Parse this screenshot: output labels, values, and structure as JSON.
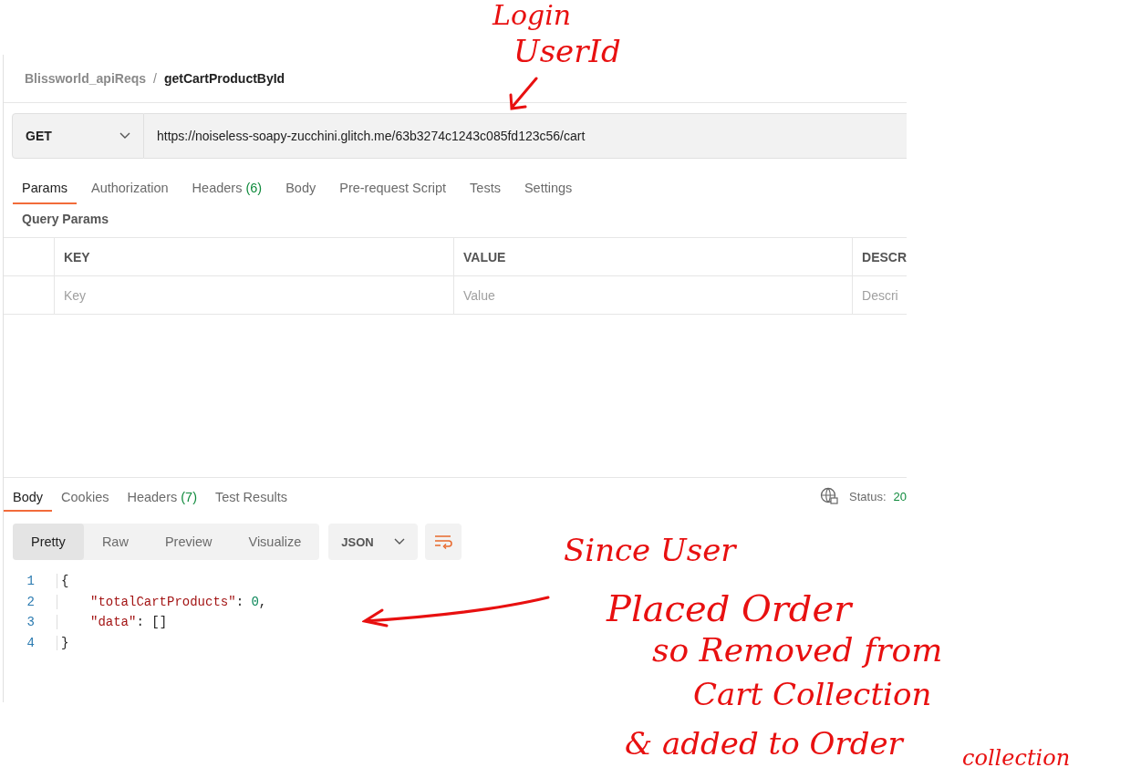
{
  "breadcrumb": {
    "collection": "Blissworld_apiReqs",
    "separator": "/",
    "request": "getCartProductById"
  },
  "request": {
    "method": "GET",
    "url": "https://noiseless-soapy-zucchini.glitch.me/63b3274c1243c085fd123c56/cart"
  },
  "request_tabs": [
    {
      "label": "Params",
      "selected": true
    },
    {
      "label": "Authorization",
      "selected": false
    },
    {
      "label": "Headers",
      "count": "(6)",
      "selected": false
    },
    {
      "label": "Body",
      "selected": false
    },
    {
      "label": "Pre-request Script",
      "selected": false
    },
    {
      "label": "Tests",
      "selected": false
    },
    {
      "label": "Settings",
      "selected": false
    }
  ],
  "query_params": {
    "title": "Query Params",
    "columns": [
      "KEY",
      "VALUE",
      "DESCR"
    ],
    "rows": [
      {
        "key_placeholder": "Key",
        "value_placeholder": "Value",
        "description_placeholder": "Descri"
      }
    ]
  },
  "response": {
    "tabs": [
      {
        "label": "Body",
        "selected": true
      },
      {
        "label": "Cookies",
        "selected": false
      },
      {
        "label": "Headers",
        "count": "(7)",
        "selected": false
      },
      {
        "label": "Test Results",
        "selected": false
      }
    ],
    "status_label": "Status:",
    "status_value": "20",
    "view_modes": [
      {
        "label": "Pretty",
        "selected": true
      },
      {
        "label": "Raw",
        "selected": false
      },
      {
        "label": "Preview",
        "selected": false
      },
      {
        "label": "Visualize",
        "selected": false
      }
    ],
    "format": "JSON",
    "code_lines": [
      {
        "number": "1",
        "indented": false,
        "tokens": [
          {
            "kind": "brace",
            "text": "{"
          }
        ]
      },
      {
        "number": "2",
        "indented": true,
        "tokens": [
          {
            "kind": "key",
            "text": "\"totalCartProducts\""
          },
          {
            "kind": "punct",
            "text": ": "
          },
          {
            "kind": "number",
            "text": "0"
          },
          {
            "kind": "punct",
            "text": ","
          }
        ]
      },
      {
        "number": "3",
        "indented": true,
        "tokens": [
          {
            "kind": "key",
            "text": "\"data\""
          },
          {
            "kind": "punct",
            "text": ": []"
          }
        ]
      },
      {
        "number": "4",
        "indented": false,
        "tokens": [
          {
            "kind": "brace",
            "text": "}"
          }
        ]
      }
    ]
  },
  "annotations": [
    "Login",
    "UserId",
    "Since User",
    "Placed Order",
    "so Removed from",
    "Cart Collection",
    "& added to Order",
    "collection"
  ]
}
